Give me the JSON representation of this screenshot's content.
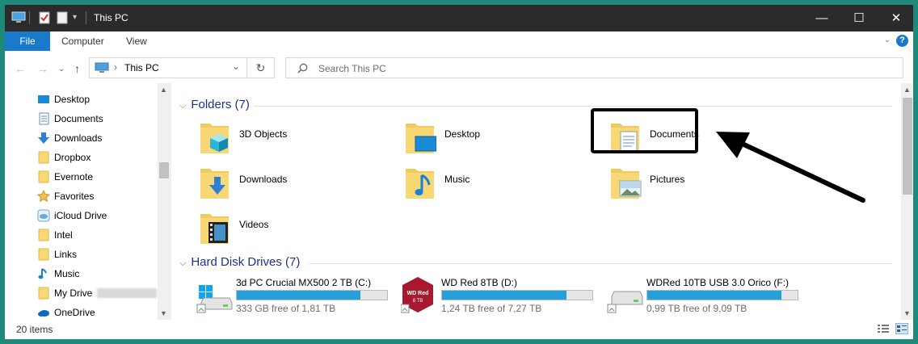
{
  "window": {
    "title": "This PC",
    "controls": {
      "minimize": "—",
      "maximize": "☐",
      "close": "✕"
    }
  },
  "ribbon": {
    "tabs": [
      "File",
      "Computer",
      "View"
    ],
    "help": "?"
  },
  "address": {
    "location": "This PC",
    "search_placeholder": "Search This PC"
  },
  "sidebar": {
    "items": [
      {
        "label": "Desktop",
        "icon": "desktop-icon"
      },
      {
        "label": "Documents",
        "icon": "documents-icon"
      },
      {
        "label": "Downloads",
        "icon": "downloads-icon"
      },
      {
        "label": "Dropbox",
        "icon": "folder-icon"
      },
      {
        "label": "Evernote",
        "icon": "folder-icon"
      },
      {
        "label": "Favorites",
        "icon": "star-icon"
      },
      {
        "label": "iCloud Drive",
        "icon": "icloud-icon"
      },
      {
        "label": "Intel",
        "icon": "folder-icon"
      },
      {
        "label": "Links",
        "icon": "folder-icon"
      },
      {
        "label": "Music",
        "icon": "music-icon"
      },
      {
        "label": "My Drive",
        "icon": "folder-icon"
      },
      {
        "label": "OneDrive",
        "icon": "onedrive-icon"
      }
    ]
  },
  "main": {
    "folders_header": "Folders (7)",
    "folders": [
      {
        "label": "3D Objects",
        "icon": "3d-objects-icon"
      },
      {
        "label": "Desktop",
        "icon": "desktop-folder-icon"
      },
      {
        "label": "Documents",
        "icon": "documents-folder-icon"
      },
      {
        "label": "Downloads",
        "icon": "downloads-folder-icon"
      },
      {
        "label": "Music",
        "icon": "music-folder-icon"
      },
      {
        "label": "Pictures",
        "icon": "pictures-folder-icon"
      },
      {
        "label": "Videos",
        "icon": "videos-folder-icon"
      }
    ],
    "drives_header": "Hard Disk Drives (7)",
    "drives": [
      {
        "name": "3d PC Crucial MX500 2 TB (C:)",
        "free": "333 GB free of 1,81 TB",
        "used_fraction": 0.82,
        "icon": "windows-drive-icon"
      },
      {
        "name": "WD Red 8TB (D:)",
        "free": "1,24 TB free of 7,27 TB",
        "used_fraction": 0.83,
        "icon": "wd-red-drive-icon",
        "badge_line1": "WD Red",
        "badge_line2": "8 TB"
      },
      {
        "name": "WDRed 10TB USB 3.0 Orico (F:)",
        "free": "0,99 TB free of 9,09 TB",
        "used_fraction": 0.89,
        "icon": "usb-drive-icon"
      }
    ]
  },
  "status": {
    "items_count": "20 items"
  },
  "colors": {
    "accent": "#1979ca",
    "drive_bar": "#26a0da",
    "section_header": "#1e3287",
    "window_bg": "#1f8a7a"
  }
}
